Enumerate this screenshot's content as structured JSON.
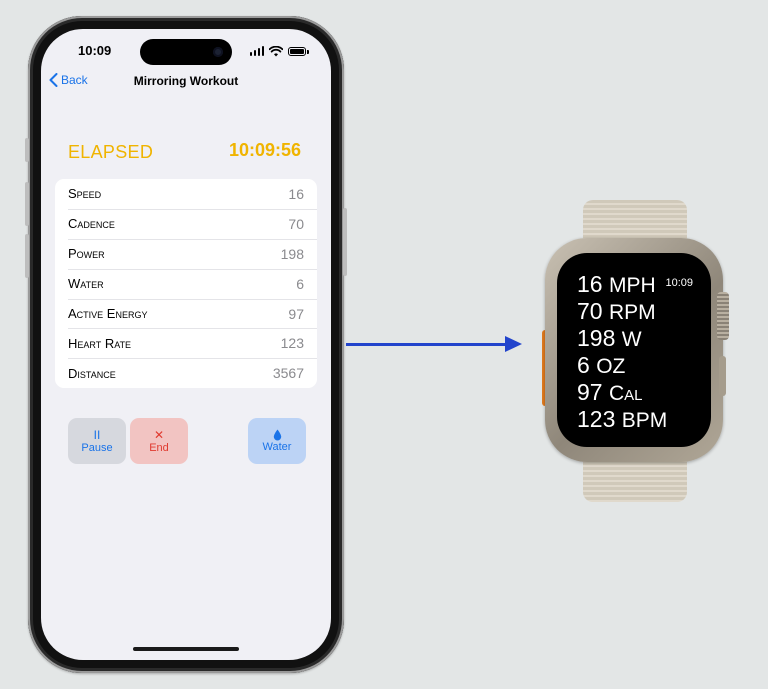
{
  "phone": {
    "status_time": "10:09",
    "nav": {
      "back_label": "Back",
      "title": "Mirroring Workout"
    },
    "elapsed": {
      "label": "ELAPSED",
      "value": "10:09:56"
    },
    "metrics": [
      {
        "label": "Speed",
        "value": "16"
      },
      {
        "label": "Cadence",
        "value": "70"
      },
      {
        "label": "Power",
        "value": "198"
      },
      {
        "label": "Water",
        "value": "6"
      },
      {
        "label": "Active Energy",
        "value": "97"
      },
      {
        "label": "Heart Rate",
        "value": "123"
      },
      {
        "label": "Distance",
        "value": "3567"
      }
    ],
    "buttons": {
      "pause": {
        "icon": "pause-icon",
        "glyph": "II",
        "label": "Pause"
      },
      "end": {
        "icon": "x-icon",
        "glyph": "✕",
        "label": "End"
      },
      "water": {
        "icon": "water-drop-icon",
        "glyph": "💧",
        "label": "Water"
      }
    }
  },
  "watch": {
    "time": "10:09",
    "lines": [
      {
        "value": "16",
        "unit": "MPH"
      },
      {
        "value": "70",
        "unit": "RPM"
      },
      {
        "value": "198",
        "unit": "W"
      },
      {
        "value": "6",
        "unit": "OZ"
      },
      {
        "value": "97",
        "unit": "Cal"
      },
      {
        "value": "123",
        "unit": "BPM"
      }
    ]
  },
  "colors": {
    "accent_blue": "#1a73e8",
    "elapsed_yellow": "#f0b400",
    "end_red": "#e03a2f",
    "arrow_blue": "#2244cc"
  }
}
